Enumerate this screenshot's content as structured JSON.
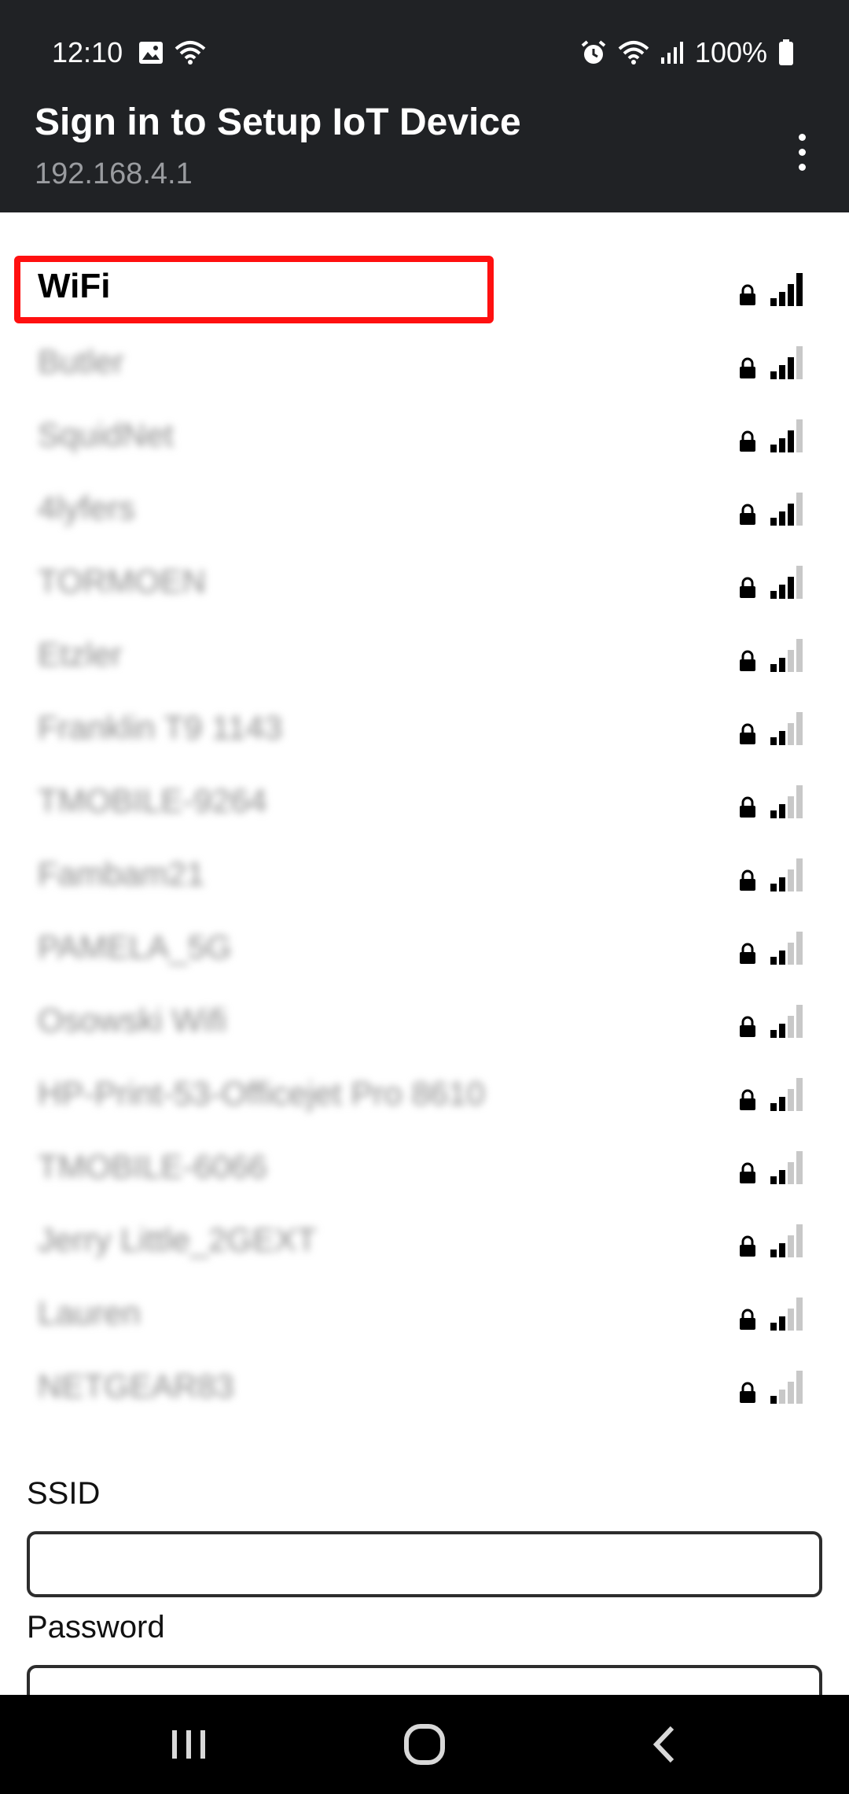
{
  "status_bar": {
    "time": "12:10",
    "battery": "100%",
    "icons_left": [
      "image-icon",
      "wifi-calling-icon"
    ],
    "icons_right": [
      "alarm-icon",
      "wifi-icon",
      "signal-icon",
      "battery-icon"
    ]
  },
  "app_bar": {
    "title": "Sign in to Setup IoT Device",
    "subtitle": "192.168.4.1",
    "menu_icon": "more-vert-icon"
  },
  "networks": [
    {
      "name": "WiFi",
      "secured": true,
      "signal_bars": 4
    },
    {
      "name": "Butler",
      "secured": true,
      "signal_bars": 3
    },
    {
      "name": "SquidNet",
      "secured": true,
      "signal_bars": 3
    },
    {
      "name": "4lyfers",
      "secured": true,
      "signal_bars": 3
    },
    {
      "name": "TORMOEN",
      "secured": true,
      "signal_bars": 3
    },
    {
      "name": "Etzler",
      "secured": true,
      "signal_bars": 2
    },
    {
      "name": "Franklin T9 1143",
      "secured": true,
      "signal_bars": 2
    },
    {
      "name": "TMOBILE-9264",
      "secured": true,
      "signal_bars": 2
    },
    {
      "name": "Fambam21",
      "secured": true,
      "signal_bars": 2
    },
    {
      "name": "PAMELA_5G",
      "secured": true,
      "signal_bars": 2
    },
    {
      "name": "Osowski Wifi",
      "secured": true,
      "signal_bars": 2
    },
    {
      "name": "HP-Print-53-Officejet Pro 8610",
      "secured": true,
      "signal_bars": 2
    },
    {
      "name": "TMOBILE-6066",
      "secured": true,
      "signal_bars": 2
    },
    {
      "name": "Jerry Little_2GEXT",
      "secured": true,
      "signal_bars": 2
    },
    {
      "name": "Lauren",
      "secured": true,
      "signal_bars": 2
    },
    {
      "name": "NETGEAR83",
      "secured": true,
      "signal_bars": 1
    }
  ],
  "form": {
    "ssid_label": "SSID",
    "ssid_value": "",
    "password_label": "Password",
    "password_value": ""
  },
  "colors": {
    "header_bg": "#202225",
    "highlight": "#ff1010",
    "bar_on": "#000000",
    "bar_off": "#c8c8c8"
  }
}
